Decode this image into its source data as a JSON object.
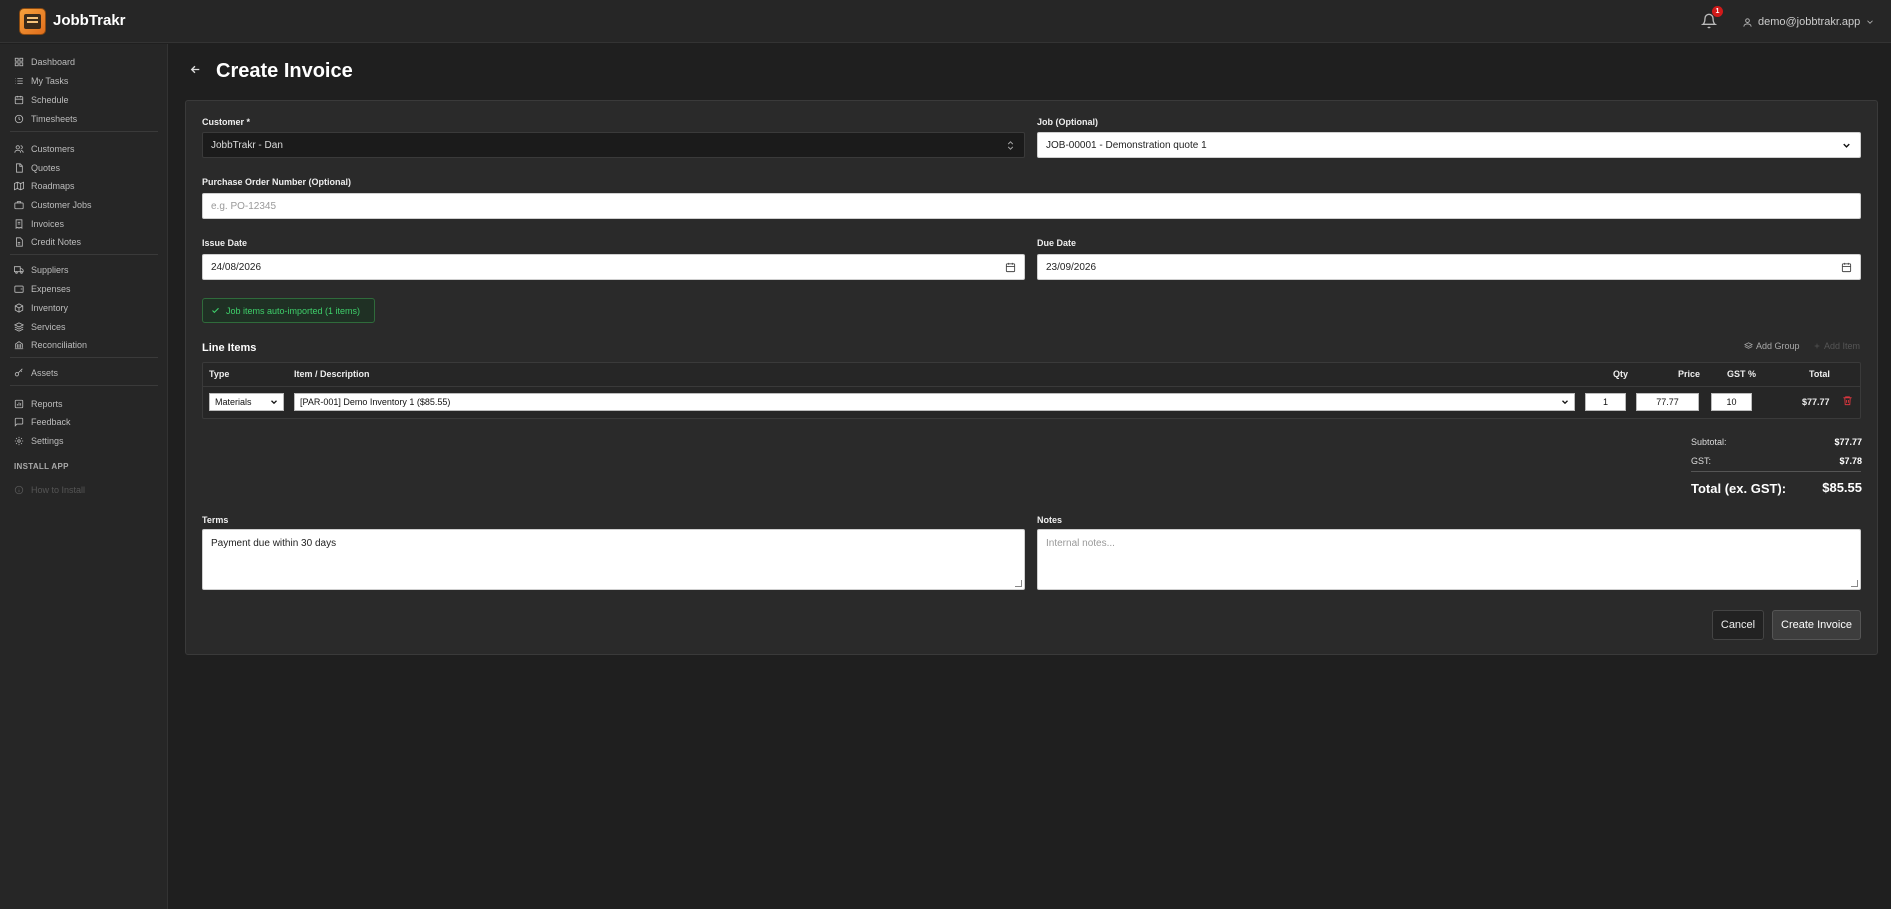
{
  "app": {
    "title": "JobbTrakr"
  },
  "header": {
    "notification_count": "1",
    "user_email": "demo@jobbtrakr.app"
  },
  "sidebar": {
    "items": [
      {
        "label": "Dashboard",
        "icon": "grid-icon"
      },
      {
        "label": "My Tasks",
        "icon": "list-icon"
      },
      {
        "label": "Schedule",
        "icon": "calendar-icon"
      },
      {
        "label": "Timesheets",
        "icon": "clock-icon"
      },
      {
        "label": "Customers",
        "icon": "users-icon"
      },
      {
        "label": "Quotes",
        "icon": "document-icon"
      },
      {
        "label": "Roadmaps",
        "icon": "map-icon"
      },
      {
        "label": "Customer Jobs",
        "icon": "briefcase-icon"
      },
      {
        "label": "Invoices",
        "icon": "receipt-icon"
      },
      {
        "label": "Credit Notes",
        "icon": "file-icon"
      },
      {
        "label": "Suppliers",
        "icon": "truck-icon"
      },
      {
        "label": "Expenses",
        "icon": "wallet-icon"
      },
      {
        "label": "Inventory",
        "icon": "package-icon"
      },
      {
        "label": "Services",
        "icon": "layers-icon"
      },
      {
        "label": "Reconciliation",
        "icon": "bank-icon"
      },
      {
        "label": "Assets",
        "icon": "key-icon"
      },
      {
        "label": "Reports",
        "icon": "chart-icon"
      },
      {
        "label": "Feedback",
        "icon": "message-icon"
      },
      {
        "label": "Settings",
        "icon": "gear-icon"
      }
    ],
    "install_title": "INSTALL APP",
    "how_to_install": "How to Install"
  },
  "page": {
    "title": "Create Invoice"
  },
  "form": {
    "customer_label": "Customer *",
    "customer_value": "JobbTrakr - Dan",
    "job_label": "Job (Optional)",
    "job_value": "JOB-00001 - Demonstration quote 1",
    "po_label": "Purchase Order Number (Optional)",
    "po_placeholder": "e.g. PO-12345",
    "issue_date_label": "Issue Date",
    "issue_date_value": "24/08/2026",
    "due_date_label": "Due Date",
    "due_date_value": "23/09/2026",
    "imported_notice": "Job items auto-imported (1 items)"
  },
  "line_items": {
    "title": "Line Items",
    "add_group": "Add Group",
    "add_item": "Add Item",
    "headers": {
      "type": "Type",
      "item": "Item / Description",
      "qty": "Qty",
      "price": "Price",
      "gst": "GST %",
      "total": "Total"
    },
    "rows": [
      {
        "type": "Materials",
        "item": "[PAR-001] Demo Inventory 1 ($85.55)",
        "qty": "1",
        "price": "77.77",
        "gst": "10",
        "total": "$77.77"
      }
    ]
  },
  "summary": {
    "subtotal_label": "Subtotal:",
    "subtotal_value": "$77.77",
    "gst_label": "GST:",
    "gst_value": "$7.78",
    "total_label": "Total (ex. GST):",
    "total_value": "$85.55"
  },
  "terms": {
    "label": "Terms",
    "value": "Payment due within 30 days"
  },
  "notes": {
    "label": "Notes",
    "placeholder": "Internal notes..."
  },
  "actions": {
    "cancel": "Cancel",
    "create": "Create Invoice"
  },
  "colors": {
    "accent_green": "#3ecf6a",
    "badge_red": "#d01a1a",
    "logo_orange": "#f6a13c",
    "delete_red": "#d9363e"
  }
}
